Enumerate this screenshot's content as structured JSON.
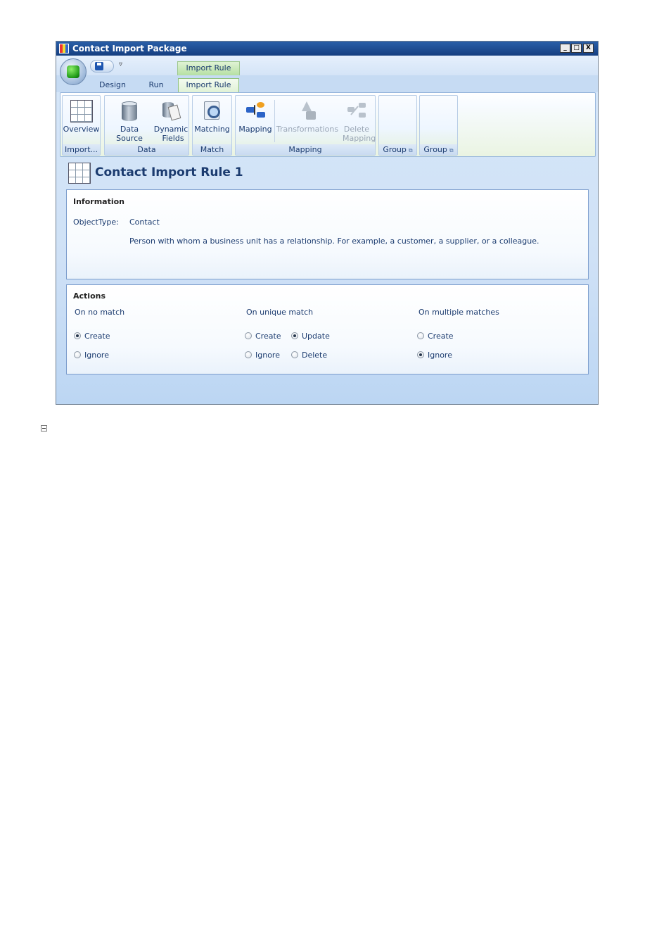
{
  "window": {
    "title": "Contact Import Package",
    "controls": [
      "_",
      "□",
      "X"
    ]
  },
  "quick_access": {
    "save_icon": "save-icon",
    "customize_glyph": "▿"
  },
  "contextual_tab_header": "Import Rule",
  "tabs": [
    {
      "label": "Design"
    },
    {
      "label": "Run"
    },
    {
      "label": "Import Rule",
      "active": true
    }
  ],
  "ribbon": {
    "groups": {
      "import": {
        "label": "Import...",
        "buttons": {
          "overview": "Overview"
        }
      },
      "data": {
        "label": "Data",
        "buttons": {
          "data_source": "Data Source",
          "dynamic_fields_1": "Dynamic",
          "dynamic_fields_2": "Fields"
        }
      },
      "match": {
        "label": "Match",
        "buttons": {
          "matching": "Matching"
        }
      },
      "mapping": {
        "label": "Mapping",
        "buttons": {
          "mapping": "Mapping",
          "transformations": "Transformations",
          "delete_mapping_1": "Delete",
          "delete_mapping_2": "Mapping"
        }
      },
      "group1": {
        "label": "Group"
      },
      "group2": {
        "label": "Group"
      }
    }
  },
  "page": {
    "title": "Contact Import Rule 1"
  },
  "information": {
    "heading": "Information",
    "object_type_label": "ObjectType:",
    "object_type_value": "Contact",
    "description": "Person with whom a business unit has a relationship. For example, a customer, a supplier, or a colleague."
  },
  "actions": {
    "heading": "Actions",
    "no_match": {
      "label": "On no match",
      "options": {
        "create": "Create",
        "ignore": "Ignore"
      },
      "selected": "Create"
    },
    "unique_match": {
      "label": "On unique match",
      "options": {
        "create": "Create",
        "update": "Update",
        "ignore": "Ignore",
        "delete": "Delete"
      },
      "selected": "Update"
    },
    "multiple_matches": {
      "label": "On multiple matches",
      "options": {
        "create": "Create",
        "ignore": "Ignore"
      },
      "selected": "Ignore"
    }
  }
}
